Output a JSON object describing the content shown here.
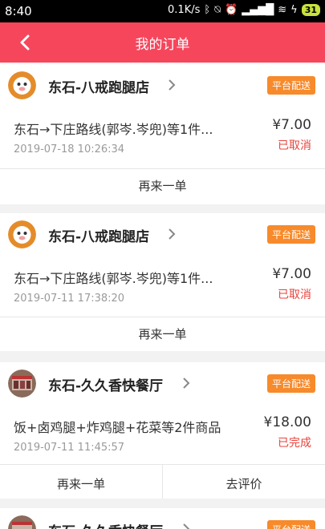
{
  "status_bar": {
    "time": "8:40",
    "network_speed": "0.1K/s",
    "battery": "31"
  },
  "header": {
    "title": "我的订单"
  },
  "orders": [
    {
      "shop_name": "东石-八戒跑腿店",
      "badge": "平台配送",
      "description": "东石→下庄路线(郭岑.岑兜)等1件...",
      "date": "2019-07-18 10:26:34",
      "price": "¥7.00",
      "status": "已取消",
      "actions": [
        "再来一单"
      ]
    },
    {
      "shop_name": "东石-八戒跑腿店",
      "badge": "平台配送",
      "description": "东石→下庄路线(郭岑.岑兜)等1件...",
      "date": "2019-07-11 17:38:20",
      "price": "¥7.00",
      "status": "已取消",
      "actions": [
        "再来一单"
      ]
    },
    {
      "shop_name": "东石-久久香快餐厅",
      "badge": "平台配送",
      "description": "饭+卤鸡腿+炸鸡腿+花菜等2件商品",
      "date": "2019-07-11 11:45:57",
      "price": "¥18.00",
      "status": "已完成",
      "actions": [
        "再来一单",
        "去评价"
      ]
    },
    {
      "shop_name": "东石-久久香快餐厅",
      "badge": "平台配送"
    }
  ],
  "colors": {
    "header": "#f6465c",
    "badge": "#f78a2b",
    "status_red": "#e8433c"
  }
}
